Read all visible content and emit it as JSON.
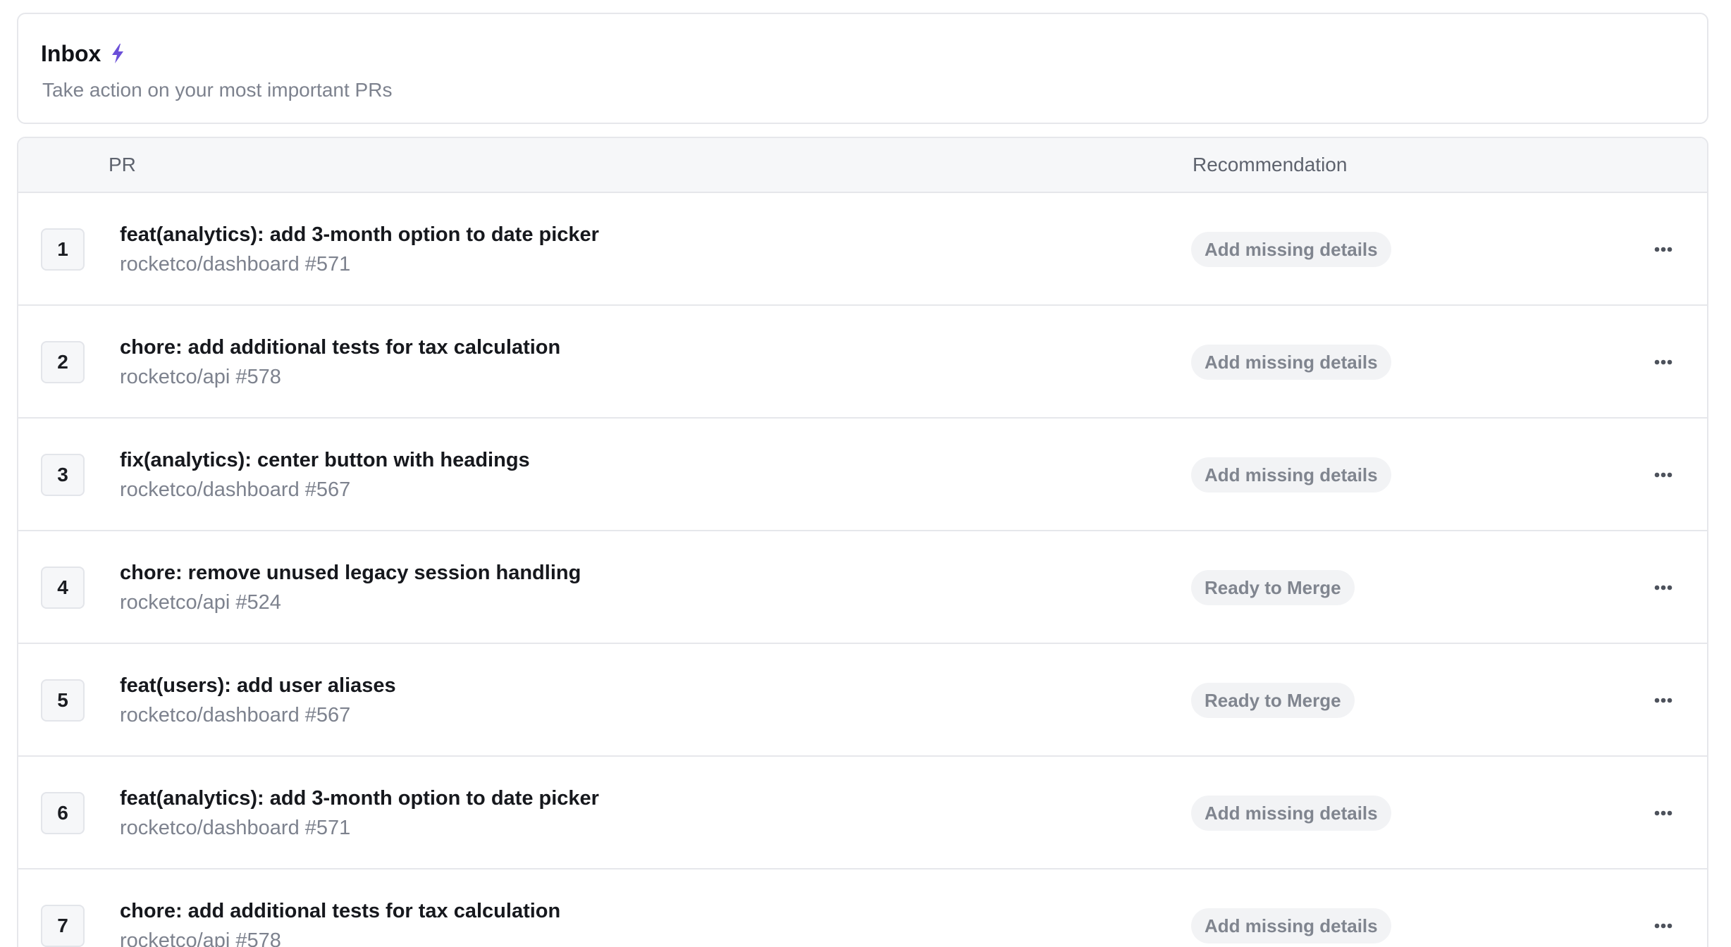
{
  "header": {
    "title": "Inbox",
    "title_icon": "bolt-icon",
    "subtitle": "Take action on your most important PRs"
  },
  "table": {
    "columns": {
      "pr": "PR",
      "recommendation": "Recommendation"
    },
    "rows": [
      {
        "index": "1",
        "title": "feat(analytics): add 3-month option to date picker",
        "repo": "rocketco/dashboard #571",
        "recommendation": "Add missing details"
      },
      {
        "index": "2",
        "title": "chore: add additional tests for tax calculation",
        "repo": "rocketco/api #578",
        "recommendation": "Add missing details"
      },
      {
        "index": "3",
        "title": "fix(analytics): center button with headings",
        "repo": "rocketco/dashboard #567",
        "recommendation": "Add missing details"
      },
      {
        "index": "4",
        "title": "chore: remove unused legacy session handling",
        "repo": "rocketco/api #524",
        "recommendation": "Ready to Merge"
      },
      {
        "index": "5",
        "title": "feat(users): add user aliases",
        "repo": "rocketco/dashboard #567",
        "recommendation": "Ready to Merge"
      },
      {
        "index": "6",
        "title": "feat(analytics): add 3-month option to date picker",
        "repo": "rocketco/dashboard #571",
        "recommendation": "Add missing details"
      },
      {
        "index": "7",
        "title": "chore: add additional tests for tax calculation",
        "repo": "rocketco/api #578",
        "recommendation": "Add missing details"
      }
    ],
    "row_action_icon": "more-horizontal-icon"
  },
  "colors": {
    "accent": "#6b4fd8",
    "border": "#e6e7eb",
    "muted_text": "#7d828e",
    "badge_bg": "#f2f3f5"
  }
}
